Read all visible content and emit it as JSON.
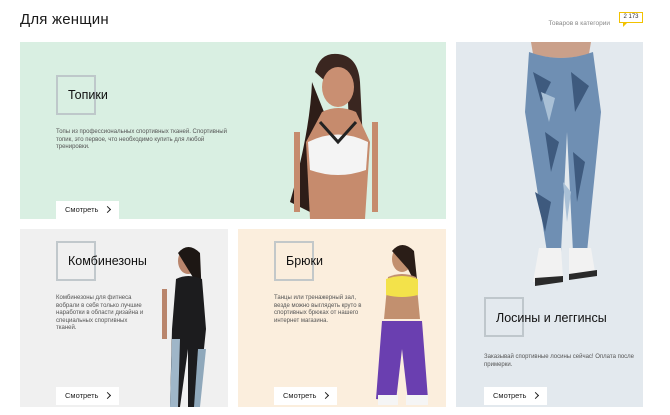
{
  "page": {
    "title": "Для женщин",
    "count_label": "Товаров в категории",
    "count_value": "2 173"
  },
  "cards": {
    "tops": {
      "title": "Топики",
      "description": "Топы из профессиональных спортивных тканей. Спортивный топик, это первое, что необходимо купить для любой тренировки.",
      "button": "Смотреть"
    },
    "overalls": {
      "title": "Комбинезоны",
      "description": "Комбинезоны для фитнеса вобрали в себя только лучшие наработки в области дизайна и специальных спортивных тканей.",
      "button": "Смотреть"
    },
    "pants": {
      "title": "Брюки",
      "description": "Танцы или тренажерный зал, везде можно выглядеть круто в спортивных брюках от нашего интернет магазина.",
      "button": "Смотреть"
    },
    "leggings": {
      "title": "Лосины и леггинсы",
      "description": "Заказывай спортивные лосины сейчас! Оплата после примерки.",
      "button": "Смотреть"
    }
  },
  "colors": {
    "tops_bg": "#d9efe2",
    "overalls_bg": "#f0f0f0",
    "pants_bg": "#fbeedd",
    "leggings_bg": "#e3e9ee",
    "badge_border": "#f2c200"
  },
  "icons": [
    "chevron-right-icon"
  ]
}
